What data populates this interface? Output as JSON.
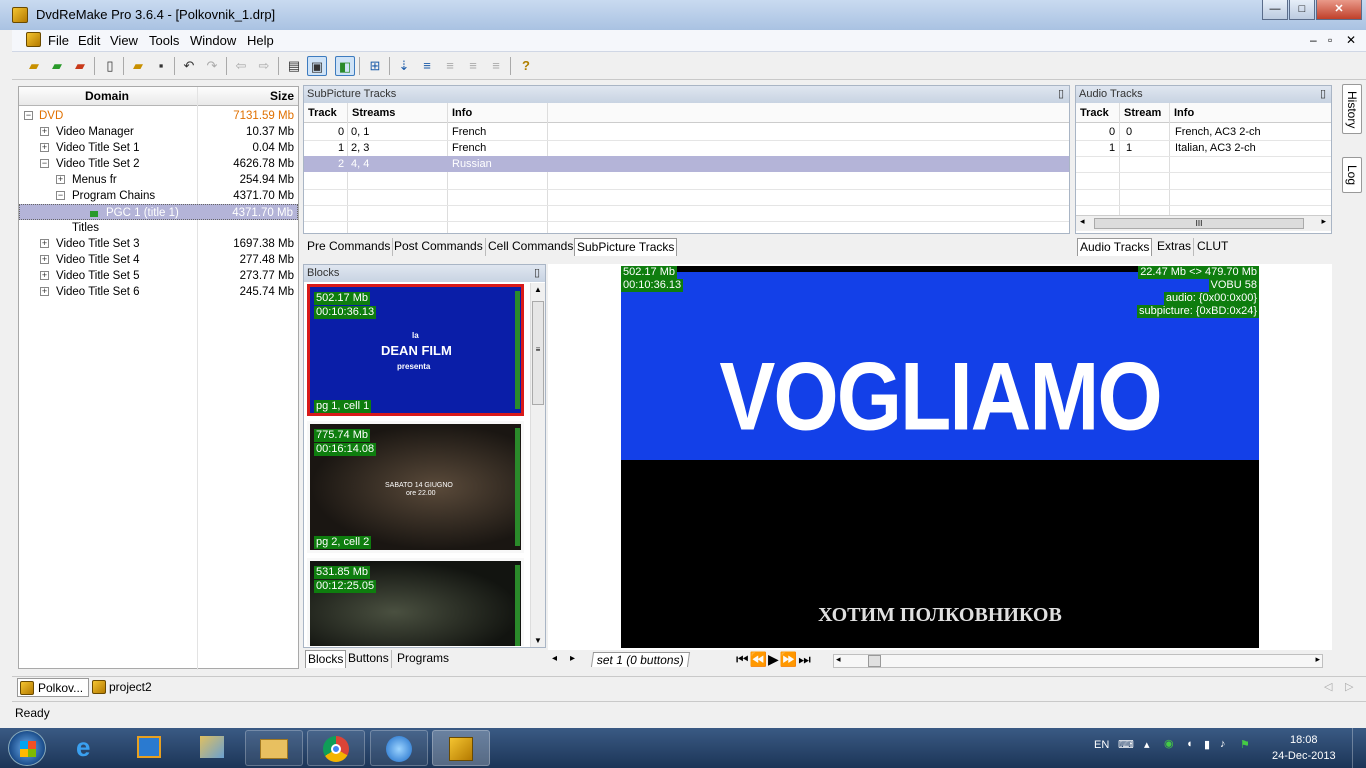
{
  "window": {
    "title": "DvdReMake Pro 3.6.4 - [Polkovnik_1.drp]",
    "min": "—",
    "max": "□",
    "close": "✕"
  },
  "menu": [
    "File",
    "Edit",
    "View",
    "Tools",
    "Window",
    "Help"
  ],
  "mdi_controls": [
    "–",
    "▫",
    "✕"
  ],
  "toolbar_icons": [
    "open-icon",
    "open-folder-icon",
    "open-recent-icon",
    "new-icon",
    "open-project-icon",
    "save-icon",
    "undo-icon",
    "redo-icon",
    "back-icon",
    "forward-icon",
    "view-grid-icon",
    "view-preview-icon",
    "view-pgc-icon",
    "structure-icon",
    "list-icon",
    "list2-icon",
    "list3-icon",
    "list4-icon",
    "help-icon"
  ],
  "tree": {
    "headers": {
      "domain": "Domain",
      "size": "Size"
    },
    "rows": [
      {
        "label": "DVD",
        "size": "7131.59 Mb",
        "color": "#e07000"
      },
      {
        "label": "Video Manager",
        "size": "10.37 Mb"
      },
      {
        "label": "Video Title Set 1",
        "size": "0.04 Mb"
      },
      {
        "label": "Video Title Set 2",
        "size": "4626.78 Mb"
      },
      {
        "label": "Menus fr",
        "size": "254.94 Mb"
      },
      {
        "label": "Program Chains",
        "size": "4371.70 Mb"
      },
      {
        "label": "PGC 1  (title 1)",
        "size": "4371.70 Mb"
      },
      {
        "label": "Titles",
        "size": ""
      },
      {
        "label": "Video Title Set 3",
        "size": "1697.38 Mb"
      },
      {
        "label": "Video Title Set 4",
        "size": "277.48 Mb"
      },
      {
        "label": "Video Title Set 5",
        "size": "273.77 Mb"
      },
      {
        "label": "Video Title Set 6",
        "size": "245.74 Mb"
      }
    ]
  },
  "subpicture": {
    "title": "SubPicture Tracks",
    "pin": "▯",
    "headers": {
      "track": "Track",
      "streams": "Streams",
      "info": "Info"
    },
    "rows": [
      {
        "track": "0",
        "streams": "0, 1",
        "info": "French"
      },
      {
        "track": "1",
        "streams": "2, 3",
        "info": "French"
      },
      {
        "track": "2",
        "streams": "4, 4",
        "info": "Russian"
      }
    ],
    "tabs": [
      "Pre Commands",
      "Post Commands",
      "Cell Commands",
      "SubPicture Tracks"
    ]
  },
  "audio": {
    "title": "Audio Tracks",
    "pin": "▯",
    "headers": {
      "track": "Track",
      "stream": "Stream",
      "info": "Info"
    },
    "rows": [
      {
        "track": "0",
        "stream": "0",
        "info": "French,  AC3 2-ch"
      },
      {
        "track": "1",
        "stream": "1",
        "info": "Italian,  AC3 2-ch"
      }
    ],
    "scroll_thumb": "III",
    "tabs": [
      "Audio Tracks",
      "Extras",
      "CLUT"
    ]
  },
  "side_tabs": [
    "History",
    "Log"
  ],
  "blocks": {
    "title": "Blocks",
    "pin": "▯",
    "items": [
      {
        "size": "502.17 Mb",
        "time": "00:10:36.13",
        "cell": "pg 1, cell 1",
        "caption1": "la",
        "caption2": "DEAN FILM",
        "caption3": "presenta"
      },
      {
        "size": "775.74 Mb",
        "time": "00:16:14.08",
        "cell": "pg 2, cell 2",
        "caption1": "SABATO 14 GIUGNO",
        "caption2": "ore 22.00"
      },
      {
        "size": "531.85 Mb",
        "time": "00:12:25.05"
      }
    ],
    "tabs": [
      "Blocks",
      "Buttons",
      "Programs"
    ]
  },
  "preview": {
    "size": "502.17 Mb",
    "time": "00:10:36.13",
    "range": "22.47 Mb <> 479.70 Mb",
    "vobu": "VOBU 58",
    "audio": "audio: {0x00:0x00}",
    "subpicture": "subpicture: {0xBD:0x24}",
    "title_text": "VOGLIAMO",
    "subtitle_text": "ХОТИМ ПОЛКОВНИКОВ"
  },
  "nav": {
    "set_label": "set 1 (0 buttons)"
  },
  "doc_tabs": [
    "Polkov...",
    "project2"
  ],
  "status": "Ready",
  "tray": {
    "lang": "EN",
    "time": "18:08",
    "date": "24-Dec-2013"
  }
}
